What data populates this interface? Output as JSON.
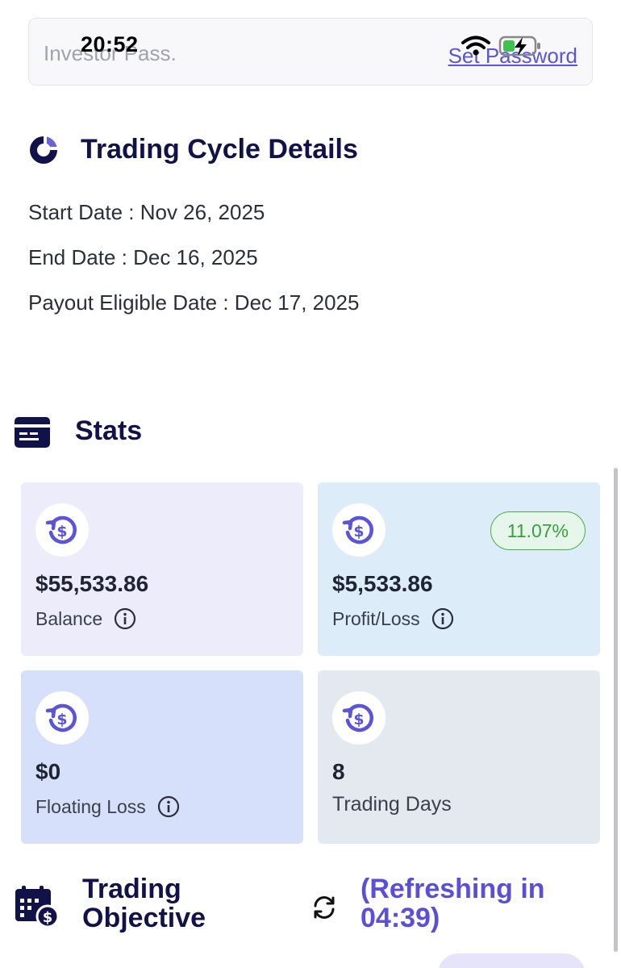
{
  "status_bar": {
    "time": "20:52"
  },
  "investor_pass": {
    "label": "Investor Pass.",
    "link": "Set Password"
  },
  "trading_cycle": {
    "title": "Trading Cycle Details",
    "start_date": "Start Date : Nov 26, 2025",
    "end_date": "End Date : Dec 16, 2025",
    "payout_date": "Payout Eligible Date : Dec 17, 2025"
  },
  "stats": {
    "title": "Stats",
    "cards": [
      {
        "value": "$55,533.86",
        "label": "Balance"
      },
      {
        "value": "$5,533.86",
        "label": "Profit/Loss",
        "badge": "11.07%"
      },
      {
        "value": "$0",
        "label": "Floating Loss"
      },
      {
        "value": "8",
        "label": "Trading Days"
      }
    ]
  },
  "trading_objective": {
    "title": "Trading Objective",
    "refresh": "(Refreshing in 04:39)"
  },
  "colors": {
    "heading": "#12124a",
    "accent": "#5a4fdb",
    "badge_green": "#46b04a",
    "balance_card": "#ececfb",
    "profit_card": "#dcecf9",
    "floating_card": "#d6e0fb",
    "days_card": "#e4e9ef"
  },
  "icons": [
    "wifi-icon",
    "battery-charging-icon",
    "cycle-icon",
    "stats-card-icon",
    "dollar-refresh-icon",
    "info-icon",
    "calendar-dollar-icon",
    "refresh-icon"
  ]
}
